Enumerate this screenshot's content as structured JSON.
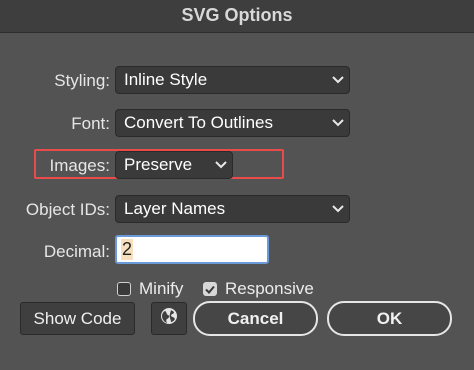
{
  "window": {
    "title": "SVG Options"
  },
  "fields": {
    "styling": {
      "label": "Styling:",
      "value": "Inline Style"
    },
    "font": {
      "label": "Font:",
      "value": "Convert To Outlines"
    },
    "images": {
      "label": "Images:",
      "value": "Preserve"
    },
    "object_ids": {
      "label": "Object IDs:",
      "value": "Layer Names"
    },
    "decimal": {
      "label": "Decimal:",
      "value": "2"
    }
  },
  "checkboxes": {
    "minify": {
      "label": "Minify",
      "checked": false
    },
    "responsive": {
      "label": "Responsive",
      "checked": true
    }
  },
  "buttons": {
    "show_code": "Show Code",
    "cancel": "Cancel",
    "ok": "OK",
    "web_icon": "globe-icon"
  },
  "colors": {
    "highlight": "#e84b4b",
    "background": "#535353"
  }
}
